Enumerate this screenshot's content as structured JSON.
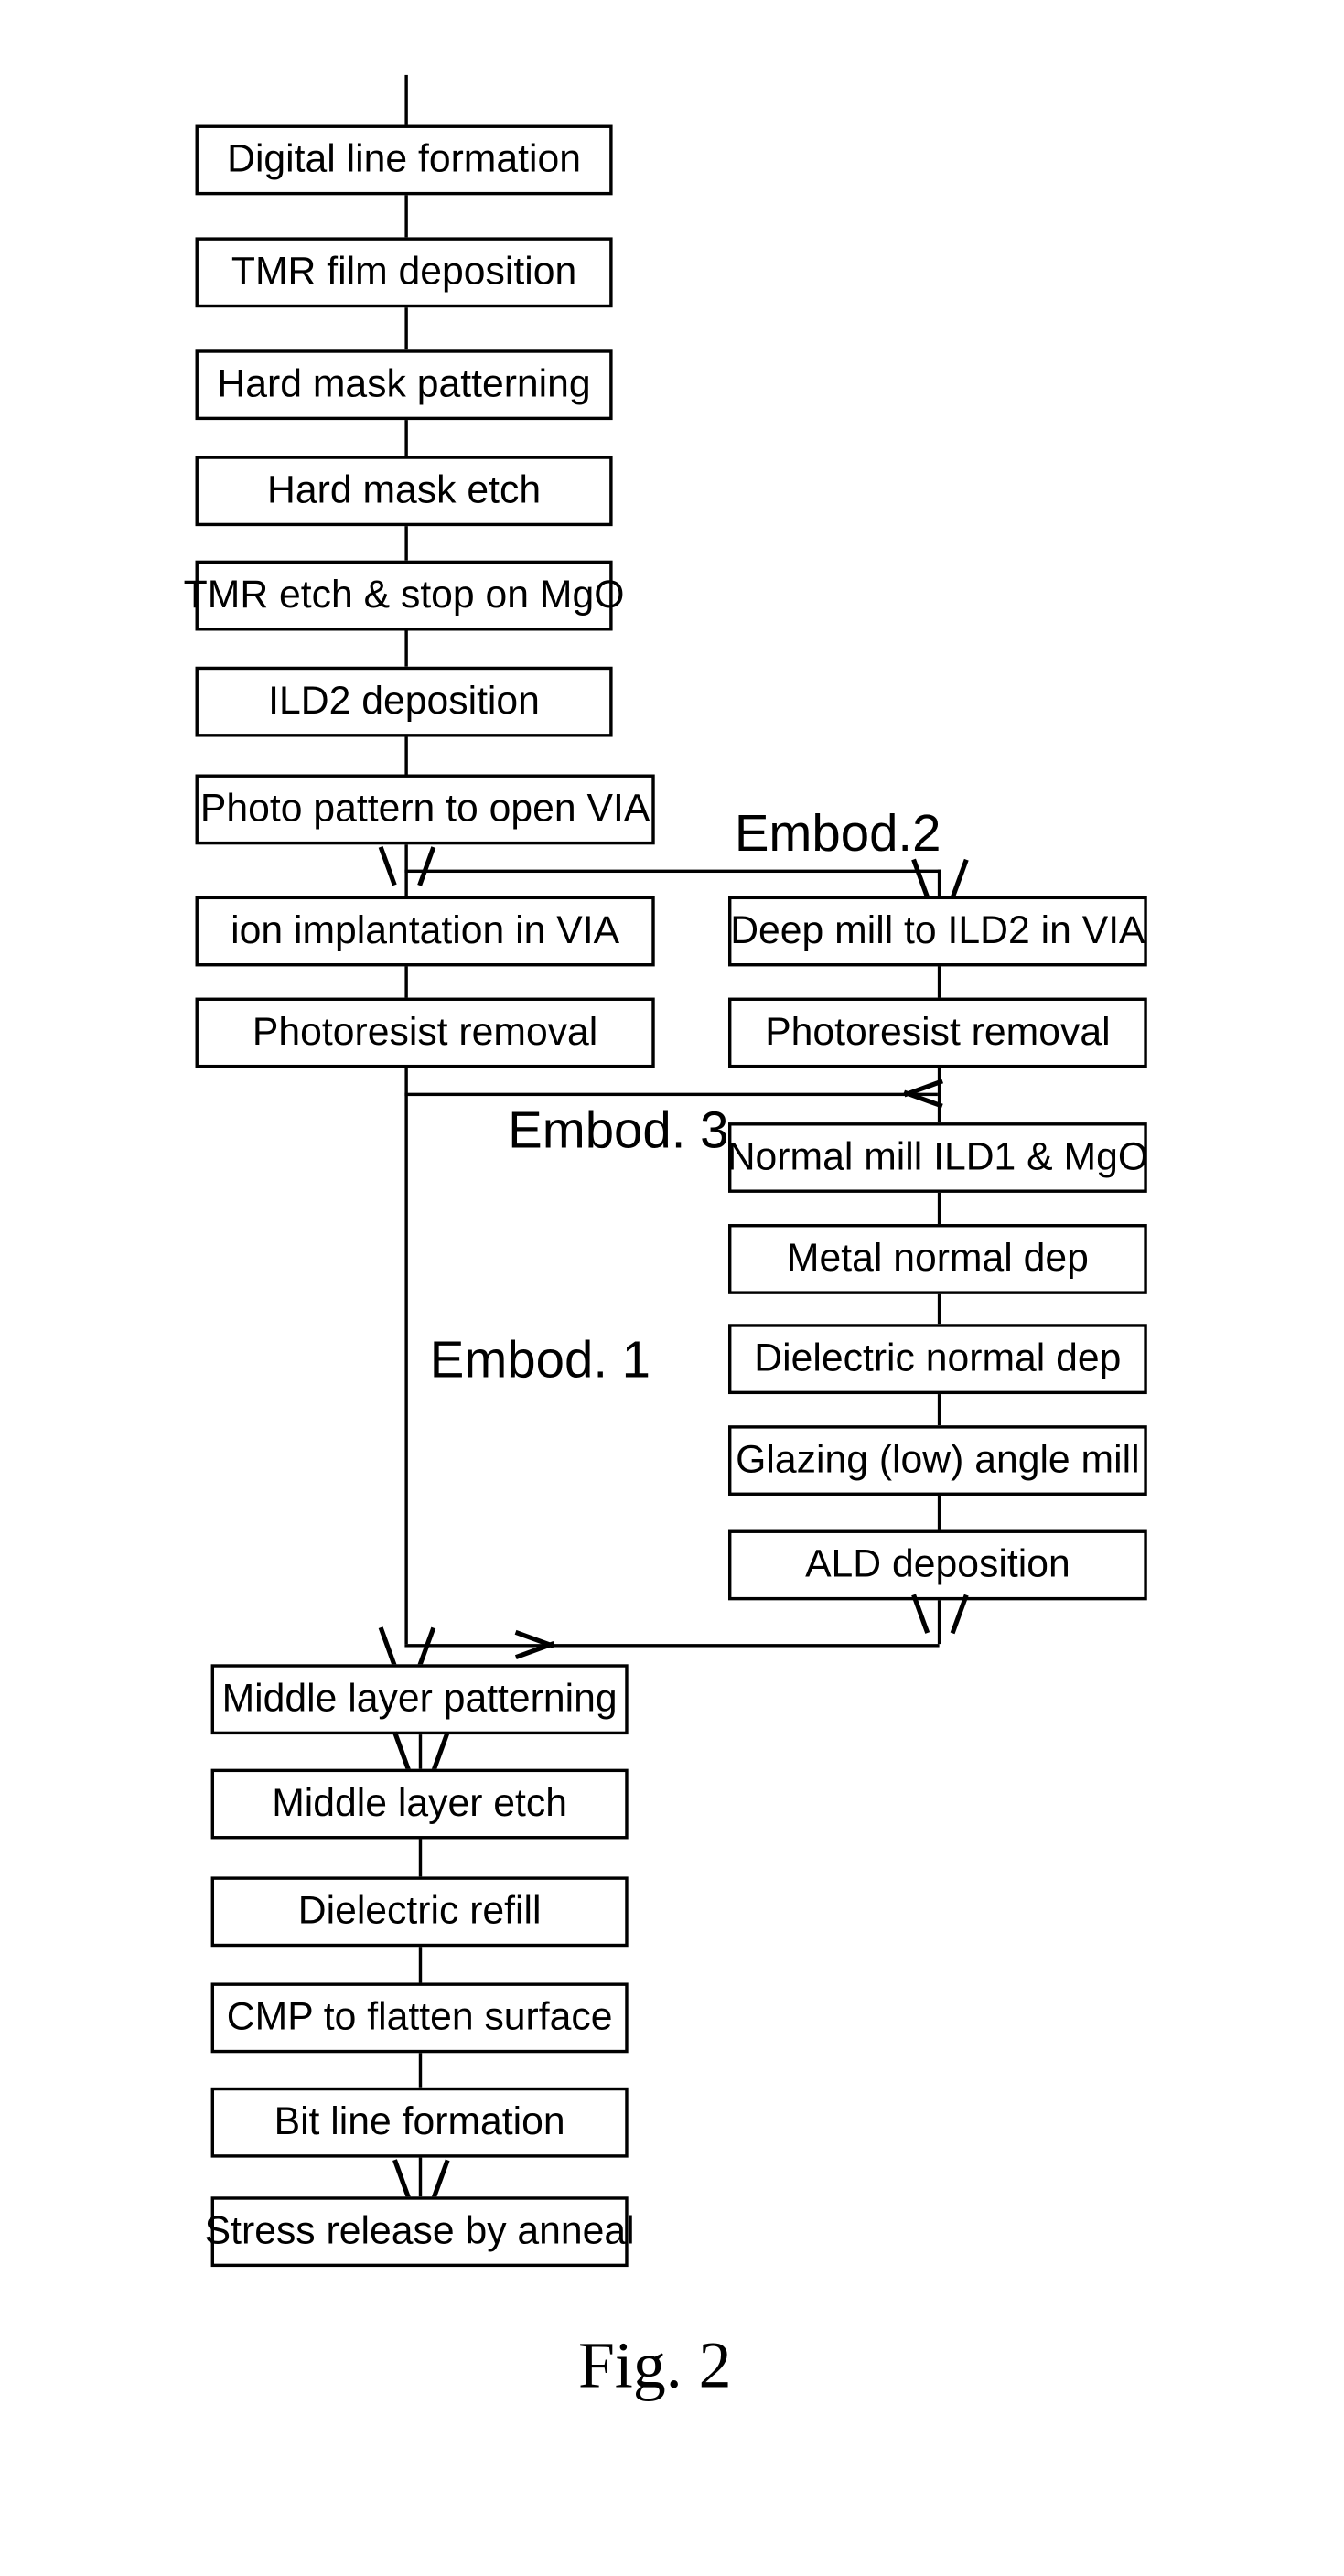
{
  "figure": {
    "caption": "Fig. 2",
    "line_color": "#000000",
    "background_color": "#ffffff"
  },
  "branch_labels": {
    "embod2": "Embod.2",
    "embod3": "Embod. 3",
    "embod1": "Embod. 1"
  },
  "main_flow": [
    {
      "id": "digital-line-formation",
      "label": "Digital line formation"
    },
    {
      "id": "tmr-film-deposition",
      "label": "TMR film deposition"
    },
    {
      "id": "hard-mask-patterning",
      "label": "Hard mask patterning"
    },
    {
      "id": "hard-mask-etch",
      "label": "Hard mask etch"
    },
    {
      "id": "tmr-etch-stop-mgo",
      "label": "TMR etch & stop on MgO"
    },
    {
      "id": "ild2-deposition",
      "label": "ILD2 deposition"
    },
    {
      "id": "photo-pattern-open-via",
      "label": "Photo pattern to open VIA"
    }
  ],
  "left_branch": [
    {
      "id": "ion-implantation-in-via",
      "label": "ion implantation in VIA"
    },
    {
      "id": "photoresist-removal-left",
      "label": "Photoresist removal"
    }
  ],
  "right_branch": [
    {
      "id": "deep-mill-to-ild2-in-via",
      "label": "Deep mill to ILD2 in VIA"
    },
    {
      "id": "photoresist-removal-right",
      "label": "Photoresist removal"
    },
    {
      "id": "normal-mill-ild1-mgo",
      "label": "Normal mill ILD1 & MgO"
    },
    {
      "id": "metal-normal-dep",
      "label": "Metal normal dep"
    },
    {
      "id": "dielectric-normal-dep",
      "label": "Dielectric normal dep"
    },
    {
      "id": "glazing-low-angle-mill",
      "label": "Glazing  (low) angle mill"
    },
    {
      "id": "ald-deposition",
      "label": "ALD deposition"
    }
  ],
  "merged_flow": [
    {
      "id": "middle-layer-patterning",
      "label": "Middle layer patterning"
    },
    {
      "id": "middle-layer-etch",
      "label": "Middle layer etch"
    },
    {
      "id": "dielectric-refill",
      "label": "Dielectric refill"
    },
    {
      "id": "cmp-to-flatten-surface",
      "label": "CMP to flatten surface"
    },
    {
      "id": "bit-line-formation",
      "label": "Bit line formation"
    },
    {
      "id": "stress-release-by-anneal",
      "label": "Stress release by anneal"
    }
  ]
}
